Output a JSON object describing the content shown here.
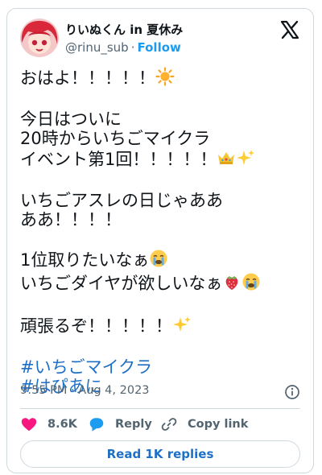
{
  "author": {
    "name": "りいぬくん in 夏休み",
    "handle": "@rinu_sub",
    "separator": "·",
    "follow_label": "Follow"
  },
  "tweet": {
    "line1": "おはよ！！！！！",
    "para2": "今日はついに\n20時からいちごマイクラ\nイベント第1回！！！！！",
    "para3": "いちごアスレの日じゃああああ！！！！",
    "para4_line1": "1位取りたいなぁ",
    "para4_line2": "いちごダイヤが欲しいなぁ",
    "line5": "頑張るぞ！！！！！",
    "hashtags": [
      "#いちごマイクラ",
      "#はぴあに"
    ],
    "timestamp": "9:55 PM · Aug 4, 2023"
  },
  "actions": {
    "like_count": "8.6K",
    "reply_label": "Reply",
    "copy_label": "Copy link"
  },
  "read_replies_label": "Read 1K replies",
  "colors": {
    "link": "#1d9bf0",
    "hashtag": "#1d70c5",
    "like": "#f91880",
    "reply": "#1d9bf0"
  },
  "icons": [
    "sun-emoji",
    "crown-emoji",
    "sparkles-emoji",
    "crying-face-emoji",
    "strawberry-emoji",
    "x-logo-icon",
    "info-icon",
    "heart-icon",
    "reply-bubble-icon",
    "link-icon"
  ]
}
